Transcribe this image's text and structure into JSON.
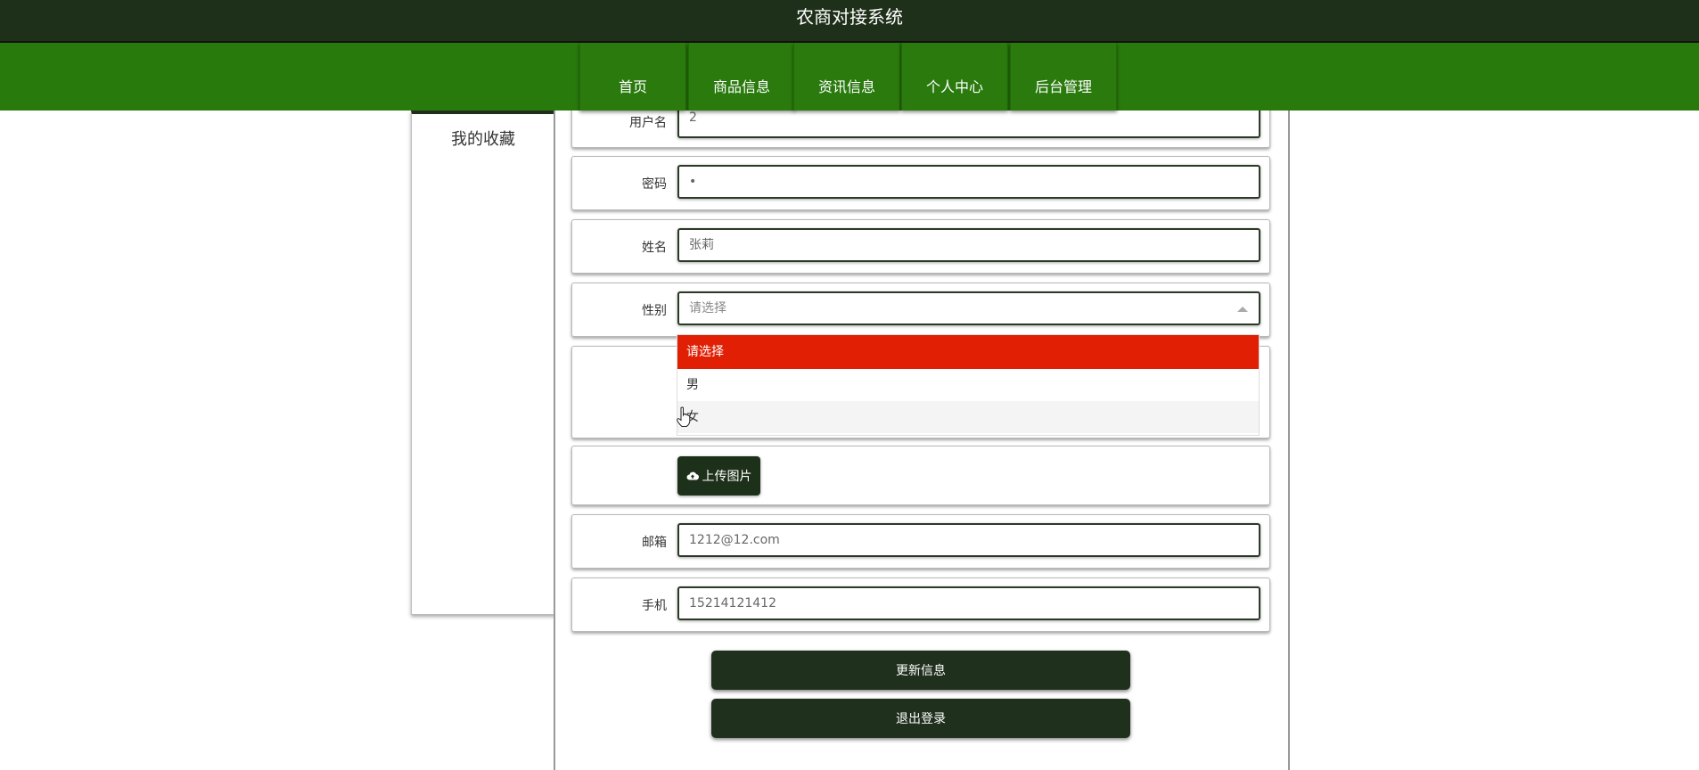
{
  "header": {
    "title": "农商对接系统"
  },
  "nav": {
    "items": [
      "首页",
      "商品信息",
      "资讯信息",
      "个人中心",
      "后台管理"
    ]
  },
  "sidebar": {
    "items": [
      "我的收藏"
    ]
  },
  "form": {
    "username": {
      "label": "用户名",
      "value": "2"
    },
    "password": {
      "label": "密码",
      "value": "•"
    },
    "name": {
      "label": "姓名",
      "value": "张莉"
    },
    "gender": {
      "label": "性别",
      "value": "请选择",
      "options": [
        "请选择",
        "男",
        "女"
      ]
    },
    "upload": {
      "label": "上传图片",
      "icon": "cloud-upload-icon"
    },
    "email": {
      "label": "邮箱",
      "value": "1212@12.com"
    },
    "phone": {
      "label": "手机",
      "value": "15214121412"
    }
  },
  "buttons": {
    "update": "更新信息",
    "logout": "退出登录"
  },
  "colors": {
    "header_bg": "#1e2f1a",
    "nav_bg": "#297a0c",
    "selected_option": "#e01f05",
    "button_bg": "#1f301c"
  }
}
